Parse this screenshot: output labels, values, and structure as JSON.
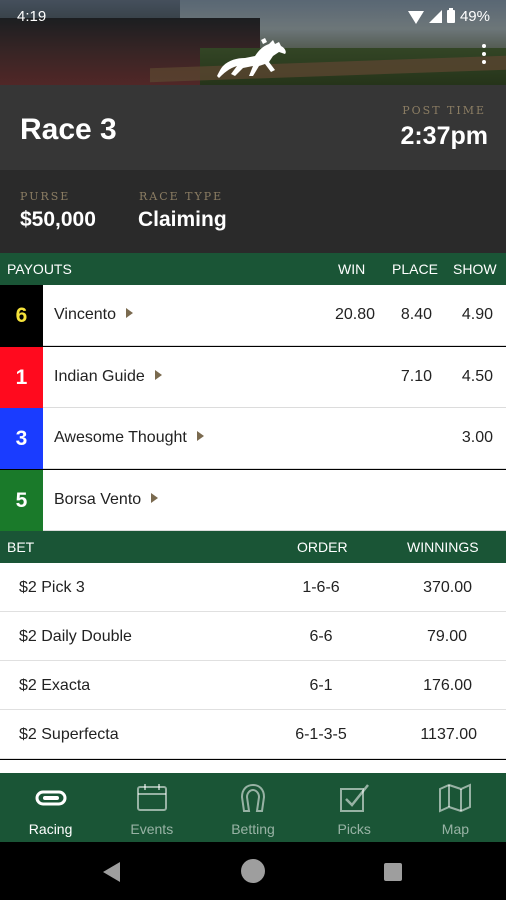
{
  "status_bar": {
    "time": "4:19",
    "battery": "49%"
  },
  "race": {
    "title": "Race 3",
    "post_time_label": "POST TIME",
    "post_time": "2:37pm",
    "purse_label": "PURSE",
    "purse": "$50,000",
    "race_type_label": "RACE TYPE",
    "race_type": "Claiming"
  },
  "payouts": {
    "headers": {
      "payouts": "PAYOUTS",
      "win": "WIN",
      "place": "PLACE",
      "show": "SHOW"
    },
    "rows": [
      {
        "number": "6",
        "name": "Vincento",
        "win": "20.80",
        "place": "8.40",
        "show": "4.90",
        "color": "#000000",
        "num_color": "#f5e23b"
      },
      {
        "number": "1",
        "name": "Indian Guide",
        "win": "",
        "place": "7.10",
        "show": "4.50",
        "color": "#ff0a1e",
        "num_color": "#ffffff"
      },
      {
        "number": "3",
        "name": "Awesome Thought",
        "win": "",
        "place": "",
        "show": "3.00",
        "color": "#1a3cff",
        "num_color": "#ffffff"
      },
      {
        "number": "5",
        "name": "Borsa Vento",
        "win": "",
        "place": "",
        "show": "",
        "color": "#1a7a2a",
        "num_color": "#ffffff"
      }
    ]
  },
  "bets": {
    "headers": {
      "bet": "BET",
      "order": "ORDER",
      "winnings": "WINNINGS"
    },
    "rows": [
      {
        "bet": "$2 Pick 3",
        "order": "1-6-6",
        "winnings": "370.00"
      },
      {
        "bet": "$2 Daily Double",
        "order": "6-6",
        "winnings": "79.00"
      },
      {
        "bet": "$2 Exacta",
        "order": "6-1",
        "winnings": "176.00"
      },
      {
        "bet": "$2 Superfecta",
        "order": "6-1-3-5",
        "winnings": "1137.00"
      }
    ]
  },
  "bottom_nav": [
    {
      "label": "Racing",
      "icon": "racing-icon",
      "active": true
    },
    {
      "label": "Events",
      "icon": "events-icon",
      "active": false
    },
    {
      "label": "Betting",
      "icon": "horseshoe-icon",
      "active": false
    },
    {
      "label": "Picks",
      "icon": "picks-icon",
      "active": false
    },
    {
      "label": "Map",
      "icon": "map-icon",
      "active": false
    }
  ],
  "colors": {
    "brand_green": "#1a5536",
    "gold_label": "#8b7d63"
  }
}
